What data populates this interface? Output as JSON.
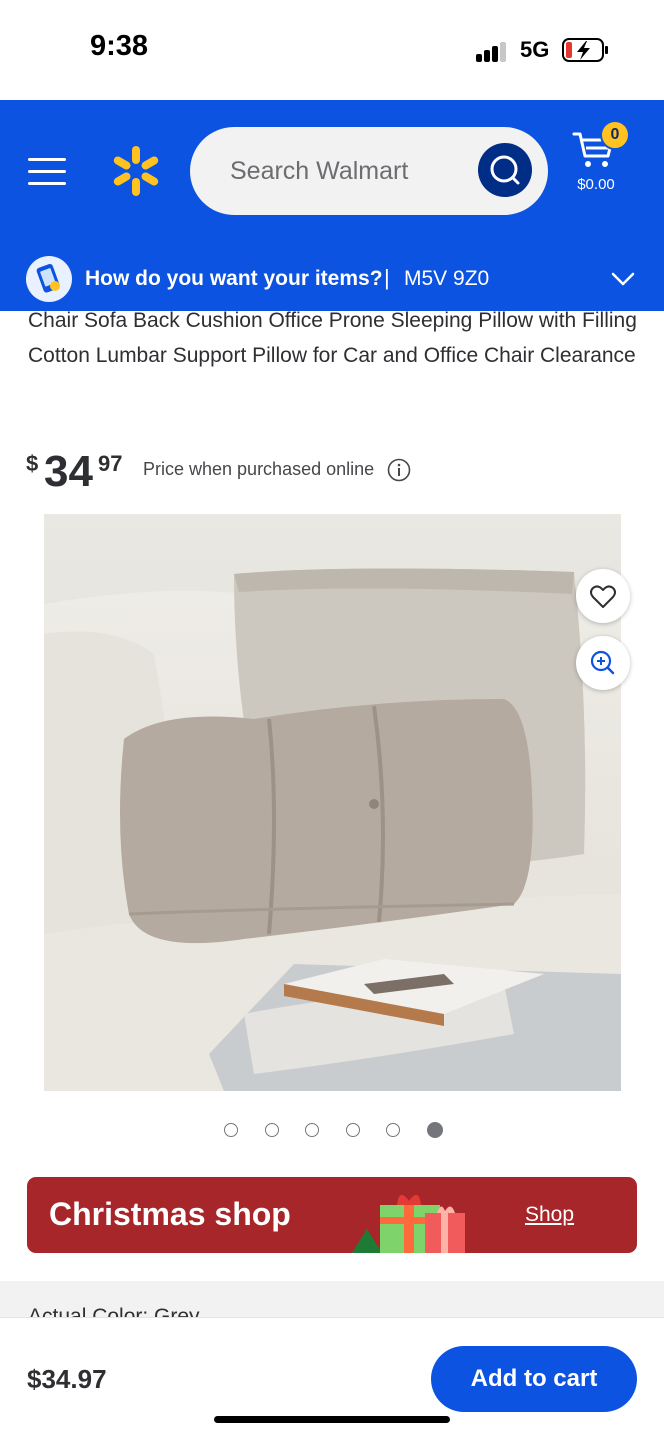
{
  "status_bar": {
    "time": "9:38",
    "network": "5G"
  },
  "header": {
    "search": {
      "placeholder": "Search Walmart"
    },
    "cart": {
      "count": "0",
      "total": "$0.00"
    },
    "fulfillment": {
      "question": "How do you want your items?",
      "separator": "|",
      "postal_code": "M5V 9Z0"
    }
  },
  "product": {
    "title": "Chair Sofa Back Cushion Office Prone Sleeping Pillow with Filling Cotton Lumbar Support Pillow for Car and Office Chair Clearance",
    "price": {
      "currency": "$",
      "dollars": "34",
      "cents": "97"
    },
    "price_note": "Price when purchased online",
    "image_count": 6,
    "active_image_index": 5,
    "color_label": "Actual Color: Grey"
  },
  "promo": {
    "title": "Christmas shop",
    "link": "Shop"
  },
  "bottom_bar": {
    "price": "$34.97",
    "add_to_cart": "Add to cart"
  },
  "colors": {
    "brand_blue": "#0b53e0",
    "spark_yellow": "#ffc220",
    "promo_red": "#a7262a"
  }
}
